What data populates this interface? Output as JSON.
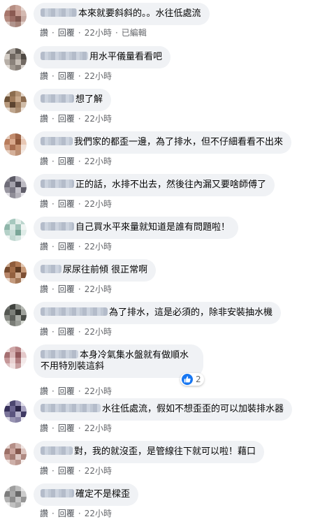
{
  "actions": {
    "like": "讚",
    "reply": "回覆",
    "edited": "已編輯"
  },
  "comments": [
    {
      "text": "本來就要斜斜的。。水往低處流",
      "time": "22小時",
      "edited": true
    },
    {
      "text": "用水平儀量看看吧",
      "time": "22小時"
    },
    {
      "text": "想了解",
      "time": "22小時"
    },
    {
      "text": "我們家的都歪一邊，為了排水，但不仔細看看不出來",
      "time": "22小時"
    },
    {
      "text": "正的話，水排不出去，然後往內漏又要啥師傅了",
      "time": "22小時"
    },
    {
      "text": "自己買水平來量就知道是誰有問題啦！",
      "time": "22小時"
    },
    {
      "text": "尿尿往前傾 很正常啊",
      "time": "22小時"
    },
    {
      "text": "為了排水，這是必須的，除非安裝抽水機",
      "time": "22小時"
    },
    {
      "text": "本身冷氣集水盤就有做順水",
      "text2": "不用特別裝這斜",
      "time": "22小時",
      "reaction": {
        "icon": "like-icon",
        "count": "2",
        "color": "#1877f2"
      }
    },
    {
      "text": "水往低處流，假如不想歪歪的可以加裝排水器",
      "time": "22小時"
    },
    {
      "text": "對，我的就沒歪，是管線往下就可以啦！藉口",
      "time": "22小時"
    },
    {
      "text": "確定不是樑歪",
      "time": "22小時"
    }
  ]
}
